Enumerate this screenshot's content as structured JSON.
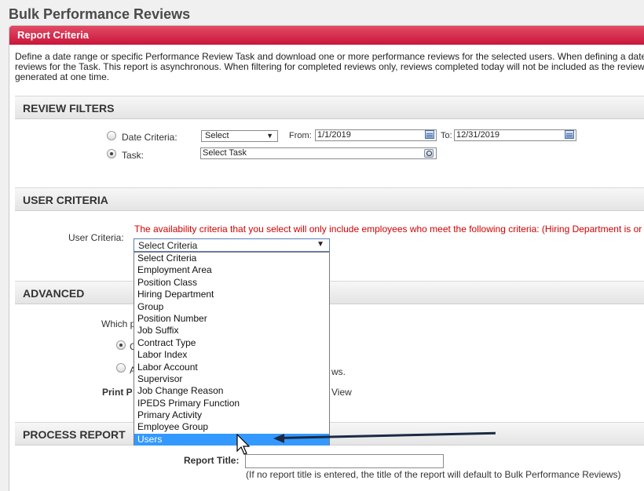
{
  "page": {
    "title": "Bulk Performance Reviews"
  },
  "panel": {
    "header": "Report Criteria",
    "intro_line1": "Define a date range or specific Performance Review Task and download one or more performance reviews for the selected users. When defining a date",
    "intro_line2": "reviews for the Task. This report is asynchronous. When filtering for completed reviews only, reviews completed today will not be included as the review",
    "intro_line3": "generated at one time."
  },
  "review_filters": {
    "heading": "REVIEW FILTERS",
    "date_criteria_label": "Date Criteria:",
    "date_select_value": "Select",
    "from_label": "From:",
    "from_value": "1/1/2019",
    "to_label": "To:",
    "to_value": "12/31/2019",
    "task_label": "Task:",
    "task_value": "Select Task",
    "selected_option": "Task"
  },
  "user_criteria": {
    "heading": "USER CRITERIA",
    "label": "User Criteria:",
    "warning": "The availability criteria that you select will only include employees who meet the following criteria: (Hiring Department is or",
    "selected_value": "Select Criteria",
    "options": [
      "Select Criteria",
      "Employment Area",
      "Position Class",
      "Hiring Department",
      "Group",
      "Position Number",
      "Job Suffix",
      "Contract Type",
      "Labor Index",
      "Labor Account",
      "Supervisor",
      "Job Change Reason",
      "IPEDS Primary Function",
      "Primary Activity",
      "Employee Group",
      "Users"
    ],
    "highlighted_option": "Users"
  },
  "advanced": {
    "heading": "ADVANCED",
    "which_prefix": "Which p",
    "option1_prefix": "C",
    "option2_prefix": "A",
    "option2_suffix": "ws.",
    "print_prefix": "Print P",
    "print_suffix": "View"
  },
  "process_report": {
    "heading": "PROCESS REPORT",
    "report_title_label": "Report Title:",
    "report_title_value": "",
    "note": "(If no report title is entered, the title of the report will default to Bulk Performance Reviews)"
  },
  "colors": {
    "header_red": "#c9163a",
    "warning_red": "#d00000",
    "highlight_blue": "#3399ff"
  }
}
